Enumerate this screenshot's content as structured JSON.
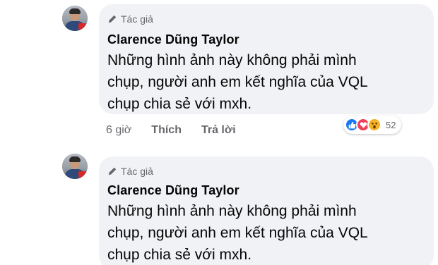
{
  "comments": [
    {
      "badge": "Tác giả",
      "author": "Clarence Dũng Taylor",
      "lines": [
        "Những hình ảnh này không phải mình",
        "chụp, người anh em kết nghĩa của VQL",
        "chụp chia sẻ với mxh."
      ],
      "time": "6 giờ",
      "like_label": "Thích",
      "reply_label": "Trả lời",
      "reaction_icons": [
        "like-icon",
        "heart-icon",
        "wow-icon"
      ],
      "reaction_count": "52"
    },
    {
      "badge": "Tác giả",
      "author": "Clarence Dũng Taylor",
      "lines": [
        "Những hình ảnh này không phải mình",
        "chụp, người anh em kết nghĩa của VQL",
        "chụp chia sẻ với mxh."
      ]
    }
  ],
  "colors": {
    "bubble": "#f0f2f5",
    "meta_text": "#65676b",
    "like_blue": "#1877f2",
    "heart_red": "#f33e58",
    "wow_yellow": "#f7b125"
  }
}
